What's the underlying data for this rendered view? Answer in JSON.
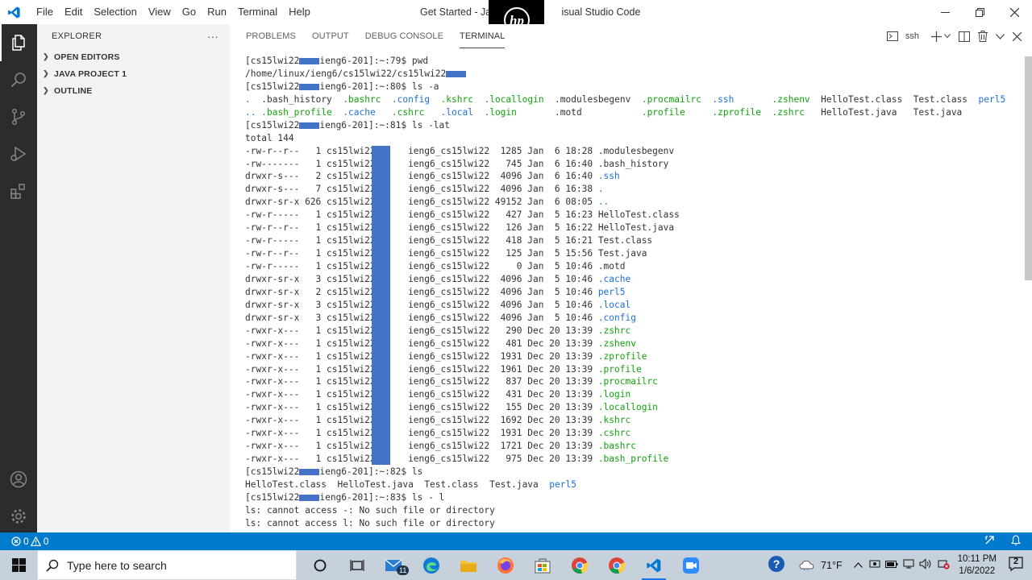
{
  "titlebar": {
    "menu": [
      "File",
      "Edit",
      "Selection",
      "View",
      "Go",
      "Run",
      "Terminal",
      "Help"
    ],
    "title_left": "Get Started - Java",
    "title_right": "isual Studio Code"
  },
  "explorer": {
    "header": "EXPLORER",
    "more": "···",
    "sections": [
      "OPEN EDITORS",
      "JAVA PROJECT 1",
      "OUTLINE"
    ]
  },
  "panel": {
    "tabs": [
      "PROBLEMS",
      "OUTPUT",
      "DEBUG CONSOLE",
      "TERMINAL"
    ],
    "active_tab": "TERMINAL",
    "terminal_name": "ssh"
  },
  "terminal": {
    "lines": [
      [
        [
          "[cs15lwi22",
          ""
        ],
        [
          "",
          "R"
        ],
        [
          "ieng6-201]:~:79$ pwd",
          ""
        ]
      ],
      [
        [
          "/home/linux/ieng6/cs15lwi22/cs15lwi22",
          ""
        ],
        [
          "",
          "R"
        ]
      ],
      [
        [
          "[cs15lwi22",
          ""
        ],
        [
          "",
          "R"
        ],
        [
          "ieng6-201]:~:80$ ls -a",
          ""
        ]
      ],
      [
        [
          ".",
          "b"
        ],
        [
          "  ",
          ""
        ],
        [
          ".bash_history",
          ""
        ],
        [
          "  ",
          ""
        ],
        [
          ".bashrc",
          "g"
        ],
        [
          "  ",
          ""
        ],
        [
          ".config",
          "b"
        ],
        [
          "  ",
          ""
        ],
        [
          ".kshrc",
          "g"
        ],
        [
          "  ",
          ""
        ],
        [
          ".locallogin",
          "g"
        ],
        [
          "  ",
          ""
        ],
        [
          ".modulesbegenv",
          ""
        ],
        [
          "  ",
          ""
        ],
        [
          ".procmailrc",
          "g"
        ],
        [
          "  ",
          ""
        ],
        [
          ".ssh",
          "b"
        ],
        [
          "       ",
          ""
        ],
        [
          ".zshenv",
          "g"
        ],
        [
          "  ",
          ""
        ],
        [
          "HelloTest.class",
          ""
        ],
        [
          "  ",
          ""
        ],
        [
          "Test.class",
          ""
        ],
        [
          "  ",
          ""
        ],
        [
          "perl5",
          "b"
        ]
      ],
      [
        [
          "..",
          "b"
        ],
        [
          " ",
          ""
        ],
        [
          ".bash_profile",
          "g"
        ],
        [
          "  ",
          ""
        ],
        [
          ".cache",
          "b"
        ],
        [
          "   ",
          ""
        ],
        [
          ".cshrc",
          "g"
        ],
        [
          "   ",
          ""
        ],
        [
          ".local",
          "b"
        ],
        [
          "  ",
          ""
        ],
        [
          ".login",
          "g"
        ],
        [
          "       ",
          ""
        ],
        [
          ".motd",
          ""
        ],
        [
          "           ",
          ""
        ],
        [
          ".profile",
          "g"
        ],
        [
          "     ",
          ""
        ],
        [
          ".zprofile",
          "g"
        ],
        [
          "  ",
          ""
        ],
        [
          ".zshrc",
          "g"
        ],
        [
          "   ",
          ""
        ],
        [
          "HelloTest.java",
          ""
        ],
        [
          "   ",
          ""
        ],
        [
          "Test.java",
          ""
        ]
      ],
      [
        [
          "[cs15lwi22",
          ""
        ],
        [
          "",
          "R"
        ],
        [
          "ieng6-201]:~:81$ ls -lat",
          ""
        ]
      ],
      [
        [
          "total 144",
          ""
        ]
      ],
      [
        [
          "-rw-r--r--   1 cs15lwi22      ieng6_cs15lwi22  1285 Jan  6 18:28 ",
          ""
        ],
        [
          ".modulesbegenv",
          ""
        ]
      ],
      [
        [
          "-rw-------   1 cs15lwi22      ieng6_cs15lwi22   745 Jan  6 16:40 ",
          ""
        ],
        [
          ".bash_history",
          ""
        ]
      ],
      [
        [
          "drwxr-s---   2 cs15lwi22      ieng6_cs15lwi22  4096 Jan  6 16:40 ",
          ""
        ],
        [
          ".ssh",
          "b"
        ]
      ],
      [
        [
          "drwxr-s---   7 cs15lwi22      ieng6_cs15lwi22  4096 Jan  6 16:38 ",
          ""
        ],
        [
          ".",
          "b"
        ]
      ],
      [
        [
          "drwxr-sr-x 626 cs15lwi22      ieng6_cs15lwi22 49152 Jan  6 08:05 ",
          ""
        ],
        [
          "..",
          "b"
        ]
      ],
      [
        [
          "-rw-r-----   1 cs15lwi22      ieng6_cs15lwi22   427 Jan  5 16:23 ",
          ""
        ],
        [
          "HelloTest.class",
          ""
        ]
      ],
      [
        [
          "-rw-r--r--   1 cs15lwi22      ieng6_cs15lwi22   126 Jan  5 16:22 ",
          ""
        ],
        [
          "HelloTest.java",
          ""
        ]
      ],
      [
        [
          "-rw-r-----   1 cs15lwi22      ieng6_cs15lwi22   418 Jan  5 16:21 ",
          ""
        ],
        [
          "Test.class",
          ""
        ]
      ],
      [
        [
          "-rw-r--r--   1 cs15lwi22      ieng6_cs15lwi22   125 Jan  5 15:56 ",
          ""
        ],
        [
          "Test.java",
          ""
        ]
      ],
      [
        [
          "-rw-r-----   1 cs15lwi22      ieng6_cs15lwi22     0 Jan  5 10:46 ",
          ""
        ],
        [
          ".motd",
          ""
        ]
      ],
      [
        [
          "drwxr-sr-x   3 cs15lwi22      ieng6_cs15lwi22  4096 Jan  5 10:46 ",
          ""
        ],
        [
          ".cache",
          "b"
        ]
      ],
      [
        [
          "drwxr-sr-x   2 cs15lwi22      ieng6_cs15lwi22  4096 Jan  5 10:46 ",
          ""
        ],
        [
          "perl5",
          "b"
        ]
      ],
      [
        [
          "drwxr-sr-x   3 cs15lwi22      ieng6_cs15lwi22  4096 Jan  5 10:46 ",
          ""
        ],
        [
          ".local",
          "b"
        ]
      ],
      [
        [
          "drwxr-sr-x   3 cs15lwi22      ieng6_cs15lwi22  4096 Jan  5 10:46 ",
          ""
        ],
        [
          ".config",
          "b"
        ]
      ],
      [
        [
          "-rwxr-x---   1 cs15lwi22      ieng6_cs15lwi22   290 Dec 20 13:39 ",
          ""
        ],
        [
          ".zshrc",
          "g"
        ]
      ],
      [
        [
          "-rwxr-x---   1 cs15lwi22      ieng6_cs15lwi22   481 Dec 20 13:39 ",
          ""
        ],
        [
          ".zshenv",
          "g"
        ]
      ],
      [
        [
          "-rwxr-x---   1 cs15lwi22      ieng6_cs15lwi22  1931 Dec 20 13:39 ",
          ""
        ],
        [
          ".zprofile",
          "g"
        ]
      ],
      [
        [
          "-rwxr-x---   1 cs15lwi22      ieng6_cs15lwi22  1961 Dec 20 13:39 ",
          ""
        ],
        [
          ".profile",
          "g"
        ]
      ],
      [
        [
          "-rwxr-x---   1 cs15lwi22      ieng6_cs15lwi22   837 Dec 20 13:39 ",
          ""
        ],
        [
          ".procmailrc",
          "g"
        ]
      ],
      [
        [
          "-rwxr-x---   1 cs15lwi22      ieng6_cs15lwi22   431 Dec 20 13:39 ",
          ""
        ],
        [
          ".login",
          "g"
        ]
      ],
      [
        [
          "-rwxr-x---   1 cs15lwi22      ieng6_cs15lwi22   155 Dec 20 13:39 ",
          ""
        ],
        [
          ".locallogin",
          "g"
        ]
      ],
      [
        [
          "-rwxr-x---   1 cs15lwi22      ieng6_cs15lwi22  1692 Dec 20 13:39 ",
          ""
        ],
        [
          ".kshrc",
          "g"
        ]
      ],
      [
        [
          "-rwxr-x---   1 cs15lwi22      ieng6_cs15lwi22  1931 Dec 20 13:39 ",
          ""
        ],
        [
          ".cshrc",
          "g"
        ]
      ],
      [
        [
          "-rwxr-x---   1 cs15lwi22      ieng6_cs15lwi22  1721 Dec 20 13:39 ",
          ""
        ],
        [
          ".bashrc",
          "g"
        ]
      ],
      [
        [
          "-rwxr-x---   1 cs15lwi22      ieng6_cs15lwi22   975 Dec 20 13:39 ",
          ""
        ],
        [
          ".bash_profile",
          "g"
        ]
      ],
      [
        [
          "[cs15lwi22",
          ""
        ],
        [
          "",
          "R"
        ],
        [
          "ieng6-201]:~:82$ ls",
          ""
        ]
      ],
      [
        [
          "HelloTest.class",
          ""
        ],
        [
          "  ",
          ""
        ],
        [
          "HelloTest.java",
          ""
        ],
        [
          "  ",
          ""
        ],
        [
          "Test.class",
          ""
        ],
        [
          "  ",
          ""
        ],
        [
          "Test.java",
          ""
        ],
        [
          "  ",
          ""
        ],
        [
          "perl5",
          "b"
        ]
      ],
      [
        [
          "[cs15lwi22",
          ""
        ],
        [
          "",
          "R"
        ],
        [
          "ieng6-201]:~:83$ ls - l",
          ""
        ]
      ],
      [
        [
          "ls: cannot access -: No such file or directory",
          ""
        ]
      ],
      [
        [
          "ls: cannot access l: No such file or directory",
          ""
        ]
      ]
    ]
  },
  "statusbar": {
    "errors": "0",
    "warnings": "0"
  },
  "taskbar": {
    "search_placeholder": "Type here to search",
    "mail_badge": "11",
    "temperature": "71°F",
    "time": "10:11 PM",
    "date": "1/6/2022",
    "notifications": "2"
  },
  "colors": {
    "activity_bar": "#2c2c2c",
    "sidebar": "#f3f3f3",
    "statusbar": "#007acc",
    "terminal_green": "#13a10e",
    "terminal_blue": "#1e6fd8",
    "redaction": "#4472c4"
  }
}
